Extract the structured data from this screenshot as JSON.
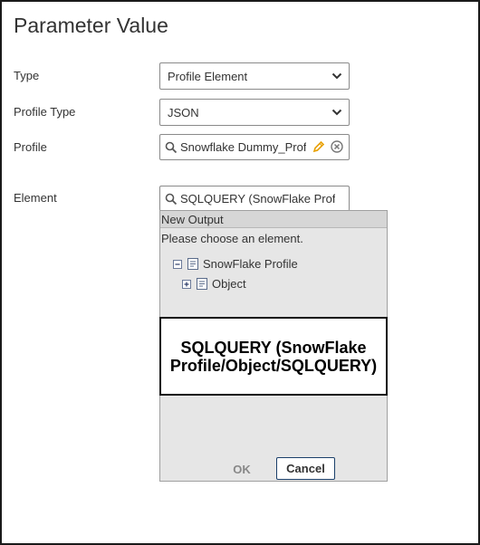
{
  "dialog": {
    "title": "Parameter Value"
  },
  "fields": {
    "type": {
      "label": "Type",
      "value": "Profile Element"
    },
    "profile_type": {
      "label": "Profile Type",
      "value": "JSON"
    },
    "profile": {
      "label": "Profile",
      "value": "Snowflake Dummy_Prof"
    },
    "element": {
      "label": "Element",
      "value": "SQLQUERY (SnowFlake Prof"
    }
  },
  "chooser": {
    "header": "New Output",
    "hint": "Please choose an element.",
    "tree": [
      {
        "label": "SnowFlake Profile",
        "toggle": "minus"
      },
      {
        "label": "Object",
        "toggle": "plus"
      }
    ],
    "tooltip_line1": "SQLQUERY (SnowFlake",
    "tooltip_line2": "Profile/Object/SQLQUERY)",
    "ok_label": "OK",
    "cancel_label": "Cancel"
  },
  "icons": {
    "caret": "chevron-down-icon",
    "search": "search-icon",
    "edit": "pencil-icon",
    "clear": "clear-circle-icon",
    "tree_collapse": "minus-box-icon",
    "tree_expand": "plus-box-icon",
    "tree_node": "document-icon"
  },
  "colors": {
    "pencil": "#e8a000",
    "popup_bg": "#e6e6e6",
    "popup_header_bg": "#d6d6d6",
    "cancel_border": "#1a3f6a"
  }
}
